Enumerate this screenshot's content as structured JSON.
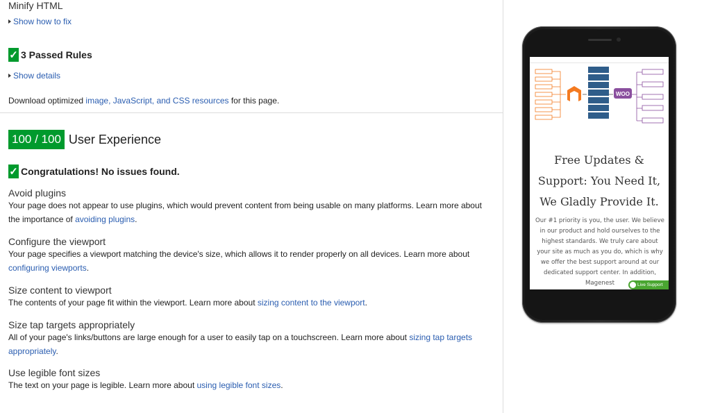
{
  "rules": {
    "minify_title": "Minify HTML",
    "show_fix": "Show how to fix",
    "passed_check": "✓",
    "passed_title": "3 Passed Rules",
    "show_details": "Show details",
    "download_prefix": "Download optimized ",
    "download_link": "image, JavaScript, and CSS resources",
    "download_suffix": " for this page."
  },
  "ux": {
    "score": "100 / 100",
    "label": "User Experience",
    "congrats": "Congratulations! No issues found.",
    "items": [
      {
        "title": "Avoid plugins",
        "text": "Your page does not appear to use plugins, which would prevent content from being usable on many platforms. Learn more about the importance of ",
        "link": "avoiding plugins",
        "end": "."
      },
      {
        "title": "Configure the viewport",
        "text": "Your page specifies a viewport matching the device's size, which allows it to render properly on all devices. Learn more about ",
        "link": "configuring viewports",
        "end": "."
      },
      {
        "title": "Size content to viewport",
        "text": "The contents of your page fit within the viewport. Learn more about ",
        "link": "sizing content to the viewport",
        "end": "."
      },
      {
        "title": "Size tap targets appropriately",
        "text": "All of your page's links/buttons are large enough for a user to easily tap on a touchscreen. Learn more about ",
        "link": "sizing tap targets appropriately",
        "end": "."
      },
      {
        "title": "Use legible font sizes",
        "text": "The text on your page is legible. Learn more about ",
        "link": "using legible font sizes",
        "end": "."
      }
    ]
  },
  "phone": {
    "hero_lines": [
      "Free Updates &",
      "Support: You Need It,",
      "We Gladly Provide It."
    ],
    "para": "Our #1 priority is you, the user. We believe in our product and hold ourselves to the highest standards. We truly care about your site as much as you do, which is why we offer the best support around at our dedicated support center. In addition, Magenest",
    "live_support": "Live Support",
    "woo": "WOO"
  },
  "colors": {
    "green": "#009a2d",
    "link": "#2a5db0",
    "phone_orange": "#f47a20",
    "phone_blue": "#2f5d8a",
    "phone_purple": "#8a4f9e"
  }
}
